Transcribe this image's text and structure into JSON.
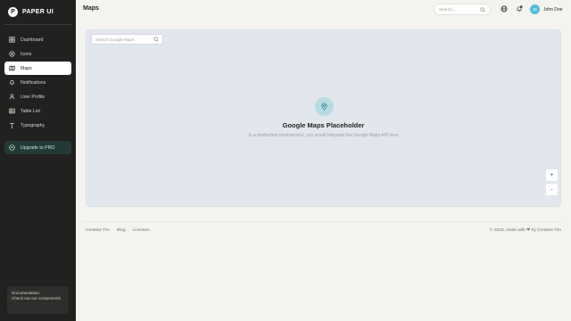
{
  "brand": {
    "logo_letter": "P",
    "name": "PAPER UI"
  },
  "sidebar": {
    "items": [
      {
        "label": "Dashboard",
        "icon": "dashboard-icon",
        "active": false
      },
      {
        "label": "Icons",
        "icon": "icons-icon",
        "active": false
      },
      {
        "label": "Maps",
        "icon": "map-icon",
        "active": true
      },
      {
        "label": "Notifications",
        "icon": "bell-icon",
        "active": false
      },
      {
        "label": "User Profile",
        "icon": "user-icon",
        "active": false
      },
      {
        "label": "Table List",
        "icon": "table-icon",
        "active": false
      },
      {
        "label": "Typography",
        "icon": "typography-icon",
        "active": false
      }
    ],
    "upgrade_label": "Upgrade to PRO",
    "doc_box": {
      "title": "Documentation",
      "text": "Check out our components"
    }
  },
  "header": {
    "title": "Maps",
    "search_placeholder": "Search...",
    "user_initials": "JD",
    "user_name": "John Doe"
  },
  "map": {
    "search_placeholder": "Search Google Maps",
    "title": "Google Maps Placeholder",
    "subtitle": "In a production environment, you would integrate the Google Maps API here",
    "zoom_in": "+",
    "zoom_out": "-"
  },
  "footer": {
    "links": [
      "Creative Tim",
      "Blog",
      "Licenses"
    ],
    "credit_prefix": "© 2024, made with",
    "credit_suffix": "by Creative Tim"
  },
  "colors": {
    "sidebar_bg": "#212120",
    "page_bg": "#f4f3ef",
    "map_bg": "#e2e6ed",
    "accent": "#51bcda",
    "upgrade_bg": "#243a36"
  }
}
